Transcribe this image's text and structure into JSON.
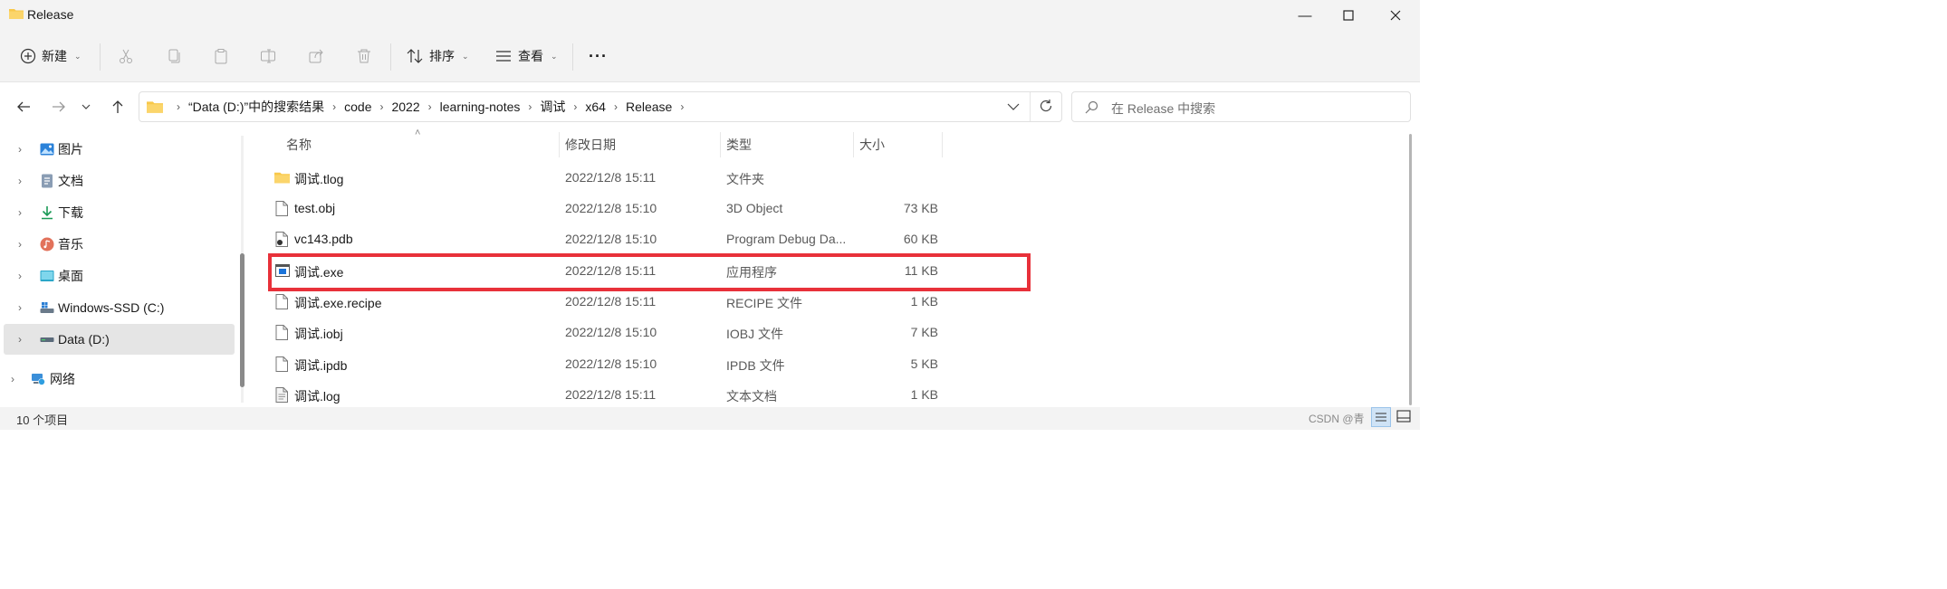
{
  "window": {
    "title": "Release"
  },
  "toolbar": {
    "new_label": "新建",
    "sort_label": "排序",
    "view_label": "查看",
    "more_label": "···"
  },
  "address": {
    "crumbs": [
      "“Data (D:)”中的搜索结果",
      "code",
      "2022",
      "learning-notes",
      "调试",
      "x64",
      "Release"
    ]
  },
  "search": {
    "placeholder": "在 Release 中搜索"
  },
  "nav": {
    "items": [
      {
        "label": "图片"
      },
      {
        "label": "文档"
      },
      {
        "label": "下载"
      },
      {
        "label": "音乐"
      },
      {
        "label": "桌面"
      },
      {
        "label": "Windows-SSD (C:)"
      },
      {
        "label": "Data (D:)"
      },
      {
        "label": "网络"
      }
    ]
  },
  "columns": {
    "name": "名称",
    "date": "修改日期",
    "type": "类型",
    "size": "大小"
  },
  "files": [
    {
      "name": "调试.tlog",
      "date": "2022/12/8 15:11",
      "type": "文件夹",
      "size": "",
      "icon": "folder-icon"
    },
    {
      "name": "test.obj",
      "date": "2022/12/8 15:10",
      "type": "3D Object",
      "size": "73 KB",
      "icon": "file-icon"
    },
    {
      "name": "vc143.pdb",
      "date": "2022/12/8 15:10",
      "type": "Program Debug Da...",
      "size": "60 KB",
      "icon": "pdb-file-icon"
    },
    {
      "name": "调试.exe",
      "date": "2022/12/8 15:11",
      "type": "应用程序",
      "size": "11 KB",
      "icon": "exe-file-icon"
    },
    {
      "name": "调试.exe.recipe",
      "date": "2022/12/8 15:11",
      "type": "RECIPE 文件",
      "size": "1 KB",
      "icon": "file-icon"
    },
    {
      "name": "调试.iobj",
      "date": "2022/12/8 15:10",
      "type": "IOBJ 文件",
      "size": "7 KB",
      "icon": "file-icon"
    },
    {
      "name": "调试.ipdb",
      "date": "2022/12/8 15:10",
      "type": "IPDB 文件",
      "size": "5 KB",
      "icon": "file-icon"
    },
    {
      "name": "调试.log",
      "date": "2022/12/8 15:11",
      "type": "文本文档",
      "size": "1 KB",
      "icon": "text-file-icon"
    }
  ],
  "status": {
    "item_count": "10 个项目"
  },
  "watermark": "CSDN @青",
  "colors": {
    "highlight": "#e8313a",
    "selected_nav": "#e5e5e5",
    "folder": "#f8c84a"
  }
}
